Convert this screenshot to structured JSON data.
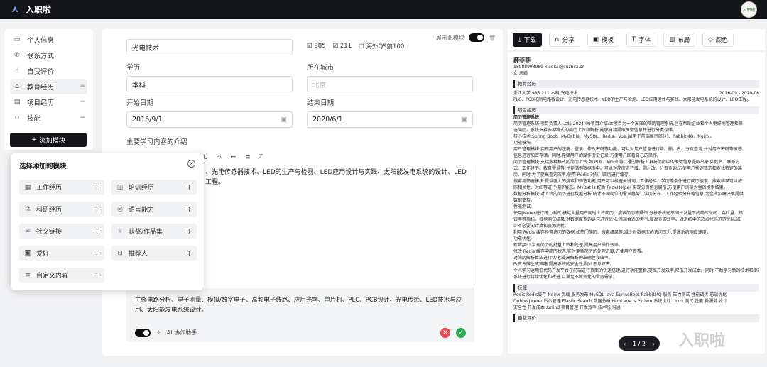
{
  "app": {
    "title": "入职啦",
    "avatar_text": "入职啦"
  },
  "nav": {
    "items": [
      {
        "icon": "id-card-icon",
        "label": "个人信息"
      },
      {
        "icon": "phone-icon",
        "label": "联系方式"
      },
      {
        "icon": "thumb-up-icon",
        "label": "自我评价"
      },
      {
        "icon": "graduation-cap-icon",
        "label": "教育经历"
      },
      {
        "icon": "document-icon",
        "label": "项目经历"
      },
      {
        "icon": "code-icon",
        "label": "技能"
      }
    ],
    "add_module_label": "添加模块"
  },
  "popup": {
    "title": "选择添加的模块",
    "modules": [
      {
        "icon": "briefcase-icon",
        "label": "工作经历"
      },
      {
        "icon": "database-icon",
        "label": "培训经历"
      },
      {
        "icon": "flask-icon",
        "label": "科研经历"
      },
      {
        "icon": "globe-icon",
        "label": "语言能力"
      },
      {
        "icon": "link-icon",
        "label": "社交链接"
      },
      {
        "icon": "trophy-icon",
        "label": "获奖/作品集"
      },
      {
        "icon": "camera-icon",
        "label": "爱好"
      },
      {
        "icon": "inbox-icon",
        "label": "推荐人"
      },
      {
        "icon": "list-icon",
        "label": "自定义内容"
      }
    ]
  },
  "editor": {
    "show_module_label": "展示此模块",
    "top_field_value": "光电技术",
    "tags": [
      "985",
      "211",
      "海外QS前100"
    ],
    "degree": {
      "label": "学历",
      "value": "本科"
    },
    "city": {
      "label": "所在城市",
      "placeholder": "北京"
    },
    "start": {
      "label": "开始日期",
      "value": "2016/9/1"
    },
    "end": {
      "label": "结束日期",
      "value": "2020/6/1"
    },
    "courses_label": "主要学习内容的介绍",
    "rich_text": "、光电传感器技术、LED的生产与检测、LED应用设计与实践、太阳能发电系统的设计、LED工程。",
    "ai_text": "主修电路分析、电子测量、模拟/数字电子、高频电子线路、应用光学、单片机、PLC、PCB设计、光电传感、LED技术与应用、太阳能发电系统设计。",
    "ai_label": "AI 协作助手"
  },
  "preview": {
    "toolbar": [
      "下载",
      "分享",
      "模板",
      "字体",
      "布局",
      "颜色"
    ],
    "name": "薛菲菲",
    "contact": "18988998989   xiaokai@ruzhila.cn",
    "gender_age": "女  未婚",
    "sections": {
      "edu": "教育经历",
      "project": "项目经历",
      "skills": "技能",
      "eval": "自我评价"
    },
    "edu_line": "浙江大学   985   211   本科     光电技术",
    "edu_date": "2016-09 - 2020-06",
    "edu_desc": "PLC、PCB印刷电路板设计、光电传感器技术、LED的生产与检测、LED应用设计与实践、太阳能发电系统的设计、LED工程。",
    "project_lines": [
      "简历管理系统",
      "简历管理系统  项目负责人  上线 2024-09项目介绍:本项目为一个高效的简历管理系统,旨在帮助企业和个人更好地管理和筛",
      "选简历。系统支持多种格式的简历上传和解析,能够自动提取关键信息并进行分类存储。",
      "核心技术:Spring Boot、MyBat is、MySQL、Redis、Vue.js(用于前端展示部分)、RabbitMQ、Nginx。",
      "功能模块:",
      "用户管理模块:实现用户的注册、登录、修改密码等功能。可以对用户信息进行增、删、改、分页查询,并对用户密码等敏感",
      "信息进行加密存储。同时,存储用户的操作历史记录,方便用户回看自己的操作。",
      "简历管理模块:支持多种格式的简历上传,如 PDF、Word 等。通过解析工具将简历中的关键信息提取出来,如姓名、联系方",
      "式、工作经历、教育背景等,并存储到数据库中。可以对简历进行增、删、改、分页查询,方便用户快速筛选和查找特定的简",
      "历。同时,为了提高查询效率,使用 Redis 对热门简历进行缓存。",
      "搜索与筛选模块:提供强大的搜索和筛选功能,用户可以根据关键词、工作经验、学历等条件进行简历搜索。搜索结果可以按",
      "照相关性、时间等进行排序展示。MyBat is 配合 PageHelper 实现分页信息展示,方便用户浏览大量的搜索结果。",
      "数据分析模块:对上传的简历进行数据分析,统计不同岗位的需求趋势、学历分布、工作经验分布等信息,为企业招聘决策提供",
      "数据支持。",
      "性能测试:",
      "使用JMeter进行压力测试,模拟大量用户同时上传简历、搜索简历等操作,分析系统在不同并发量下的响应时间、吞吐量、错",
      "误率等指标。根据测试结果,对数据库查询语句进行优化,添加合适的索引,提高查询效率。对系统中的热点代码进行优化,减",
      "少不必要的计算和资源消耗。",
      "利用 Redis 缓存经常访问的数据,如热门简历、搜索结果等,减少对数据库的访问压力,提高系统响应速度。",
      "功能优化:",
      "新增接口,实现简历的批量上传和处理,提高用户操作效率。",
      "修改 Redis 缓存中简历状态,实时更新简历的处理进度,方便用户查看。",
      "对简历解析算法进行优化,提高解析的准确性和效率。",
      "改变令牌生成策略,提高系统的安全性,防止恶意攻击。",
      "个人学习运用低代码开发平台在前端进行页面的快速搭建,进行功能整合,提高开发效率,降低开发成本。同时,不断学习新的技术和框架,对",
      "系统进行持续优化和改进,以满足不断变化的业务需求。"
    ],
    "skill_lines": [
      "Redis Redis缓存 Nginx  负载  服务发布 MySQL  Java SpringBoot  RabbitMQ  服务  压力测试  性能调优  前端优化",
      "Dubbo JMeter 后台管理  Elastic Search  数据分析  Html  Vue.js  Python 系统设计  Linux  测试  性能  微服务  设计",
      "安全性  开发成本  Xmind  项目管理  开发效率  技术栈  沟通"
    ],
    "pager": {
      "current": "1",
      "total": "2",
      "text": "1 / 2"
    },
    "watermark": "入职啦"
  }
}
